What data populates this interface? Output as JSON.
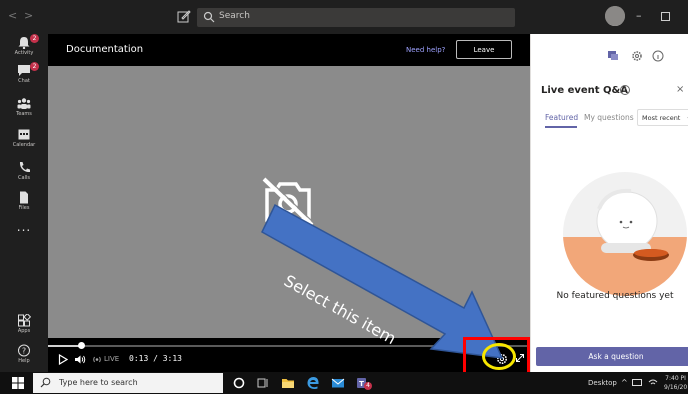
{
  "titlebar": {
    "back_glyph": "<",
    "forward_glyph": ">",
    "search_placeholder": "Search",
    "minimize_glyph": "–",
    "icons": [
      "compose-icon",
      "search-icon",
      "avatar",
      "minimize-icon",
      "maximize-icon"
    ]
  },
  "rail": {
    "items": [
      {
        "label": "Activity",
        "icon": "bell-icon",
        "badge": "2"
      },
      {
        "label": "Chat",
        "icon": "chat-icon",
        "badge": "2"
      },
      {
        "label": "Teams",
        "icon": "teams-icon"
      },
      {
        "label": "Calendar",
        "icon": "calendar-icon"
      },
      {
        "label": "Calls",
        "icon": "phone-icon"
      },
      {
        "label": "Files",
        "icon": "file-icon"
      },
      {
        "label": "...",
        "icon": "more-icon"
      },
      {
        "label": "Apps",
        "icon": "apps-icon"
      },
      {
        "label": "Help",
        "icon": "help-icon"
      }
    ]
  },
  "meeting": {
    "title": "Documentation",
    "need_help": "Need help?",
    "leave_label": "Leave"
  },
  "player": {
    "progress_fraction": 0.069,
    "live_label": "LIVE",
    "time": "0:13 / 3:13"
  },
  "qa_panel": {
    "title": "Live event Q&A",
    "info_glyph": "?",
    "close_glyph": "×",
    "tabs": [
      "Featured",
      "My questions"
    ],
    "sort_value": "Most recent",
    "empty_message": "No featured questions yet",
    "ask_button": "Ask a question"
  },
  "annotation": {
    "callout_text": "Select this item",
    "arrow_color": "#4472c4",
    "highlight_box_color": "#ff0000",
    "highlight_circle_color": "#f7e600"
  },
  "taskbar": {
    "search_placeholder": "Type here to search",
    "desktop_label": "Desktop",
    "tray_chevron": "^",
    "clock_time": "7:40 PI",
    "clock_date": "9/16/20",
    "teams_badge": "4"
  },
  "colors": {
    "teams_purple": "#6264a7",
    "dark_chrome": "#1f1f1f",
    "video_bg": "#8b8b8b"
  }
}
